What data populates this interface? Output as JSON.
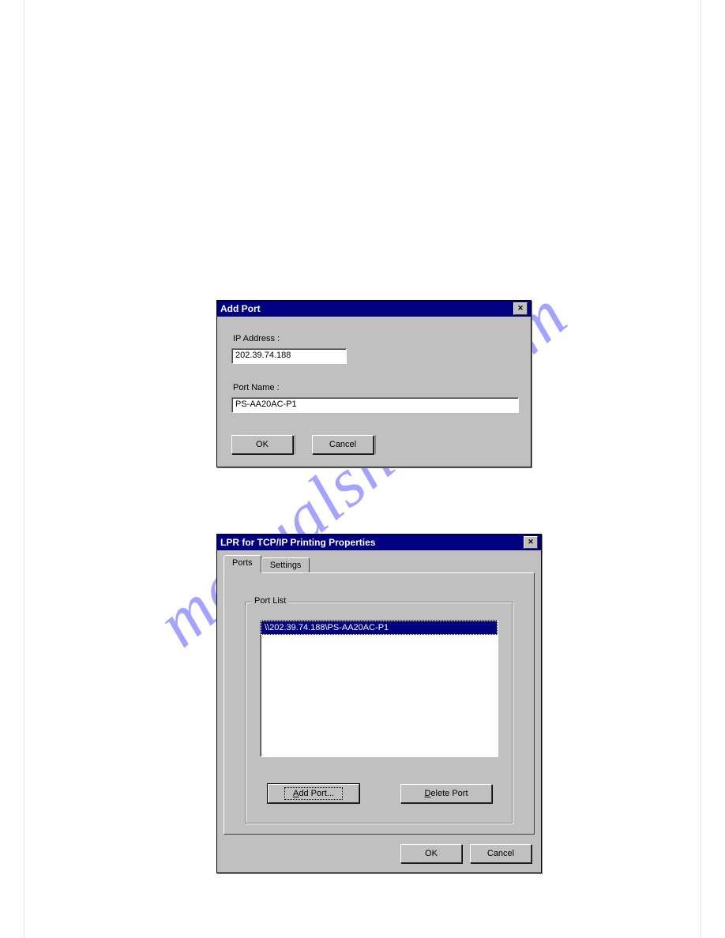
{
  "watermark": "manualshive.com",
  "add_port": {
    "title": "Add Port",
    "labels": {
      "ip": "IP Address :",
      "port": "Port Name :"
    },
    "values": {
      "ip": "202.39.74.188",
      "port": "PS-AA20AC-P1"
    },
    "buttons": {
      "ok": "OK",
      "cancel": "Cancel"
    }
  },
  "props": {
    "title": "LPR for TCP/IP Printing Properties",
    "tabs": {
      "ports": "Ports",
      "settings": "Settings"
    },
    "group_label": "Port List",
    "list_items": [
      "\\\\202.39.74.188\\PS-AA20AC-P1"
    ],
    "buttons": {
      "add_html": "<span class='underline-char'>A</span>dd Port...",
      "delete_html": "<span class='underline-char'>D</span>elete Port",
      "ok": "OK",
      "cancel": "Cancel"
    }
  }
}
